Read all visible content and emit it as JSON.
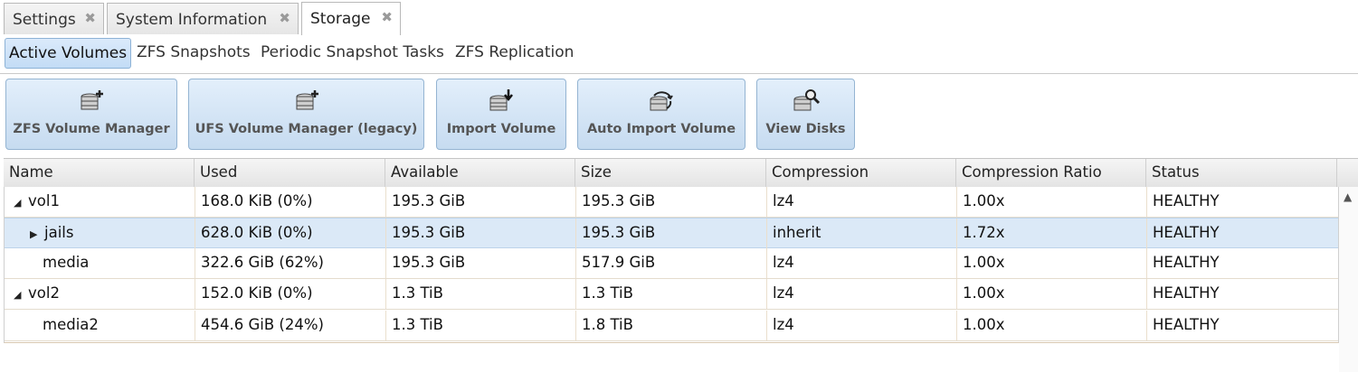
{
  "tabs": [
    {
      "label": "Settings",
      "close": "✖"
    },
    {
      "label": "System Information",
      "close": "✖"
    },
    {
      "label": "Storage",
      "close": "✖"
    }
  ],
  "subtabs": [
    "Active Volumes",
    "ZFS Snapshots",
    "Periodic Snapshot Tasks",
    "ZFS Replication"
  ],
  "toolbar": {
    "zfs_volume_manager": "ZFS Volume Manager",
    "ufs_volume_manager": "UFS Volume Manager (legacy)",
    "import_volume": "Import Volume",
    "auto_import_volume": "Auto Import Volume",
    "view_disks": "View Disks"
  },
  "columns": [
    "Name",
    "Used",
    "Available",
    "Size",
    "Compression",
    "Compression Ratio",
    "Status"
  ],
  "rows": [
    {
      "expander": "◢",
      "name": "vol1",
      "used": "168.0 KiB (0%)",
      "available": "195.3 GiB",
      "size": "195.3 GiB",
      "compression": "lz4",
      "ratio": "1.00x",
      "status": "HEALTHY"
    },
    {
      "expander": "▶",
      "name": "jails",
      "used": "628.0 KiB (0%)",
      "available": "195.3 GiB",
      "size": "195.3 GiB",
      "compression": "inherit",
      "ratio": "1.72x",
      "status": "HEALTHY"
    },
    {
      "expander": "",
      "name": "media",
      "used": "322.6 GiB (62%)",
      "available": "195.3 GiB",
      "size": "517.9 GiB",
      "compression": "lz4",
      "ratio": "1.00x",
      "status": "HEALTHY"
    },
    {
      "expander": "◢",
      "name": "vol2",
      "used": "152.0 KiB (0%)",
      "available": "1.3 TiB",
      "size": "1.3 TiB",
      "compression": "lz4",
      "ratio": "1.00x",
      "status": "HEALTHY"
    },
    {
      "expander": "",
      "name": "media2",
      "used": "454.6 GiB (24%)",
      "available": "1.3 TiB",
      "size": "1.8 TiB",
      "compression": "lz4",
      "ratio": "1.00x",
      "status": "HEALTHY"
    }
  ],
  "scroll_up_glyph": "▲",
  "colors": {
    "selected_row": "#dbe9f7",
    "button_bg": "#c6dbf0",
    "active_subtab": "#c3dcf5"
  }
}
